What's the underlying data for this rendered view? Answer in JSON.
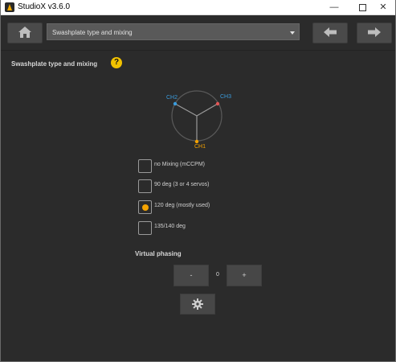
{
  "window": {
    "title": "StudioX v3.6.0",
    "controls": {
      "minimize": "—",
      "close": "✕"
    }
  },
  "toolbar": {
    "page_selector_value": "Swashplate type and mixing"
  },
  "main": {
    "section_title": "Swashplate type and mixing",
    "help_label": "?",
    "channels": [
      {
        "label": "CH2",
        "color": "#3a9bdc"
      },
      {
        "label": "CH3",
        "color": "#3a9bdc"
      },
      {
        "label": "CH1",
        "color": "#f5a300"
      }
    ],
    "mixing_options": [
      {
        "label": "no Mixing (mCCPM)",
        "selected": false
      },
      {
        "label": "90 deg (3 or 4 servos)",
        "selected": false
      },
      {
        "label": "120 deg (mostly used)",
        "selected": true
      },
      {
        "label": "135/140 deg",
        "selected": false
      }
    ],
    "virtual_phasing": {
      "title": "Virtual phasing",
      "minus_label": "-",
      "plus_label": "+",
      "value": "0"
    }
  },
  "colors": {
    "background": "#2b2b2b",
    "accent": "#f5a300",
    "help_badge": "#f2c200",
    "channel_blue": "#3a9bdc"
  }
}
